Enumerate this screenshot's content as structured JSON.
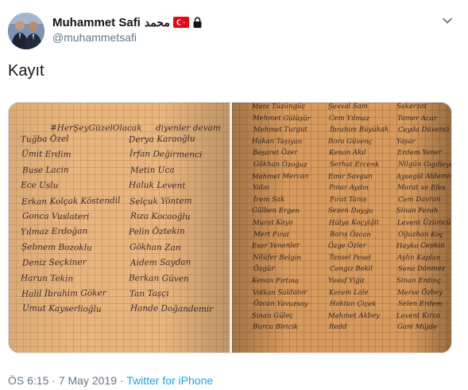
{
  "user": {
    "display_name": "Muhammet Safi",
    "arabic_name": "محمد",
    "handle": "@muhammetsafi",
    "flag_icon": "turkey-flag-icon",
    "lock_icon": "lock-icon"
  },
  "tweet": {
    "text": "Kayıt",
    "time": "ÖS 6:15",
    "separator": "·",
    "date": "7 May 2019",
    "separator2": "·",
    "source": "Twitter for iPhone"
  },
  "notebook": {
    "left_header": {
      "hashtag": "#HerŞeyGüzelOlacak",
      "suffix": "diyenler devam"
    },
    "left_col1": [
      "Tuğba Özel",
      "Ümit Erdim",
      "Buse Lacin",
      "Ece Uslu",
      "Erkan Kolçak Köstendil",
      "Gonca Vuslateri",
      "Yılmaz Erdoğan",
      "Şebnem Bozoklu",
      "Deniz Seçkiner",
      "Harun Tekin",
      "Halil İbrahim Göker",
      "Umut Kayserlioğlu"
    ],
    "left_col2": [
      "Derya Karaoğlu",
      "İrfan Değirmenci",
      "Metin Uca",
      "Haluk Levent",
      "Selçuk Yöntem",
      "Rıza Kocaoğlu",
      "Pelin Öztekin",
      "Gökhan Zan",
      "Aidem Saydan",
      "Berkan Güven",
      "Tan Taşçı",
      "Hande Doğandemir"
    ],
    "right_col1": [
      "Mete Tüzüngüç",
      "Mehmet Gülüşür",
      "Mehmet Turgut",
      "Hakan Taşıyan",
      "Beşaret Özer",
      "Gökhan Özoğuz",
      "Mehmet Mercan",
      "Yalın",
      "İrem Sak",
      "Gülben Ergen",
      "Murat Kaya",
      "Mert Fırat",
      "Eser Yenenler",
      "Nilüfer Belgin",
      "Özgür",
      "Kenan Fırtına",
      "Volkan Saldator",
      "Özcan Yavuzsoy",
      "Sinan Güleç",
      "Burcu Biricik"
    ],
    "right_col2": [
      "Şevval Sam",
      "Cem Yılmaz",
      "İbrahim Büyükak",
      "Bora Güvenç",
      "Kenan Akıl",
      "Serhat Ercenk",
      "Emir Savgun",
      "Pınar Aydın",
      "Fırat Tanış",
      "Sezen Duygu",
      "Hülya Koçyiğit",
      "Barış Özcan",
      "Özge Özler",
      "Tansel Pesel",
      "Cengiz Bekil",
      "Yusuf Yiğit",
      "Kerem Lale",
      "Haktan Çiçek",
      "Mehmet Akbey",
      "Redd"
    ],
    "right_col3": [
      "Sekerzat",
      "Tamer Acar",
      "Ceyda Düvenci",
      "Yaşar",
      "Erdem Yener",
      "Nilgün Gıgılleyen",
      "Aysegül Aldemir",
      "Murat ve Efes",
      "Cem Davran",
      "Sinan Ferah",
      "Levent Üzümcü",
      "Oğuzhan Koç",
      "Hayko Cepkin",
      "Aylin Kaplan",
      "Sena Dönmez",
      "Sinan Erdinç",
      "Merve Özbey",
      "Selen Erdem",
      "Levent Kırca",
      "Gani Müjde"
    ]
  }
}
